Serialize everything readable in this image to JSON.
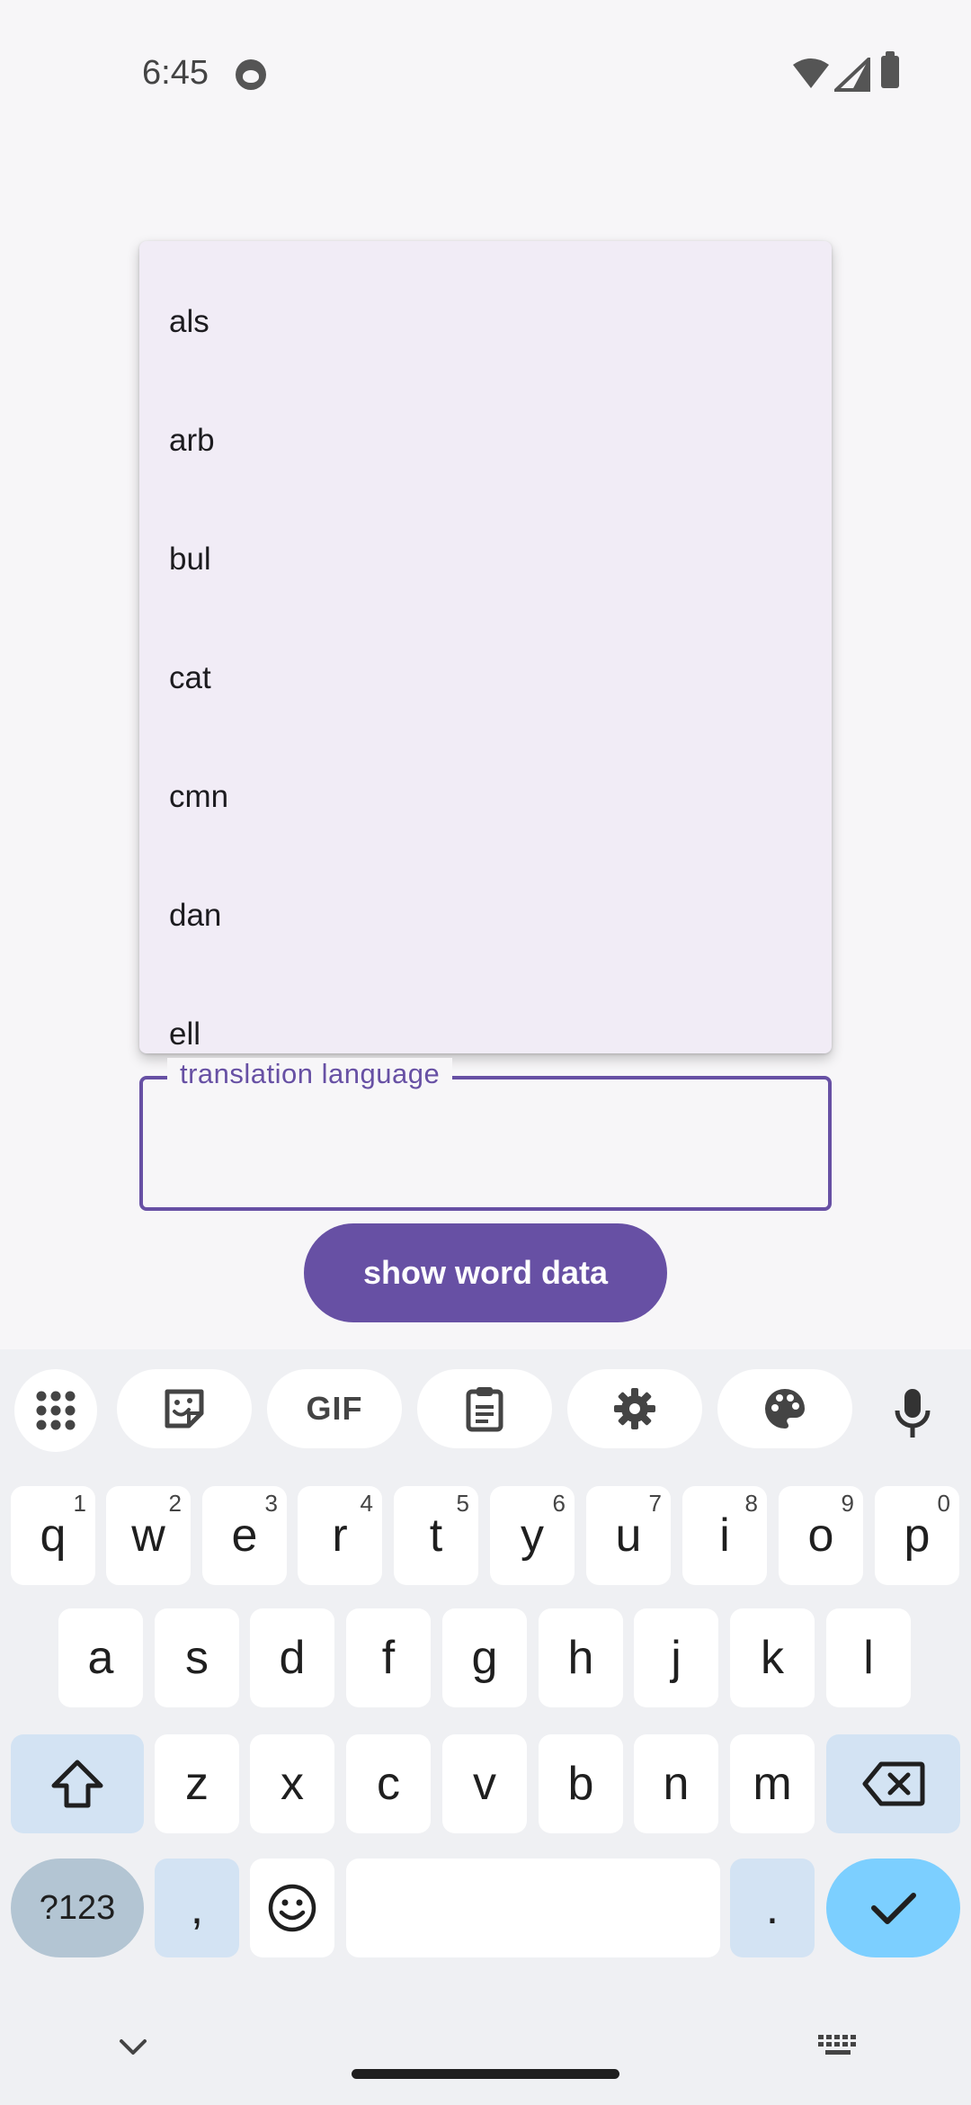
{
  "status_bar": {
    "time": "6:45"
  },
  "dropdown": {
    "items": [
      "als",
      "arb",
      "bul",
      "cat",
      "cmn",
      "dan",
      "ell"
    ]
  },
  "form": {
    "translation_label": "translation language",
    "translation_value": "",
    "button_label": "show word data"
  },
  "colors": {
    "primary": "#6750a4",
    "menu_bg": "#f1ecf6",
    "keyboard_bg": "#eff0f3",
    "enter_key": "#7ccfff"
  },
  "keyboard": {
    "toolbar": {
      "gif_label": "GIF"
    },
    "row1": [
      {
        "key": "q",
        "hint": "1"
      },
      {
        "key": "w",
        "hint": "2"
      },
      {
        "key": "e",
        "hint": "3"
      },
      {
        "key": "r",
        "hint": "4"
      },
      {
        "key": "t",
        "hint": "5"
      },
      {
        "key": "y",
        "hint": "6"
      },
      {
        "key": "u",
        "hint": "7"
      },
      {
        "key": "i",
        "hint": "8"
      },
      {
        "key": "o",
        "hint": "9"
      },
      {
        "key": "p",
        "hint": "0"
      }
    ],
    "row2": [
      "a",
      "s",
      "d",
      "f",
      "g",
      "h",
      "j",
      "k",
      "l"
    ],
    "row3": [
      "z",
      "x",
      "c",
      "v",
      "b",
      "n",
      "m"
    ],
    "row4": {
      "symbols": "?123",
      "comma": ",",
      "period": "."
    },
    "icons": [
      "apps-grid-icon",
      "sticker-icon",
      "clipboard-icon",
      "settings-icon",
      "palette-icon",
      "mic-icon",
      "shift-icon",
      "backspace-icon",
      "emoji-icon",
      "checkmark-icon",
      "chevron-down-icon",
      "keyboard-icon"
    ]
  }
}
